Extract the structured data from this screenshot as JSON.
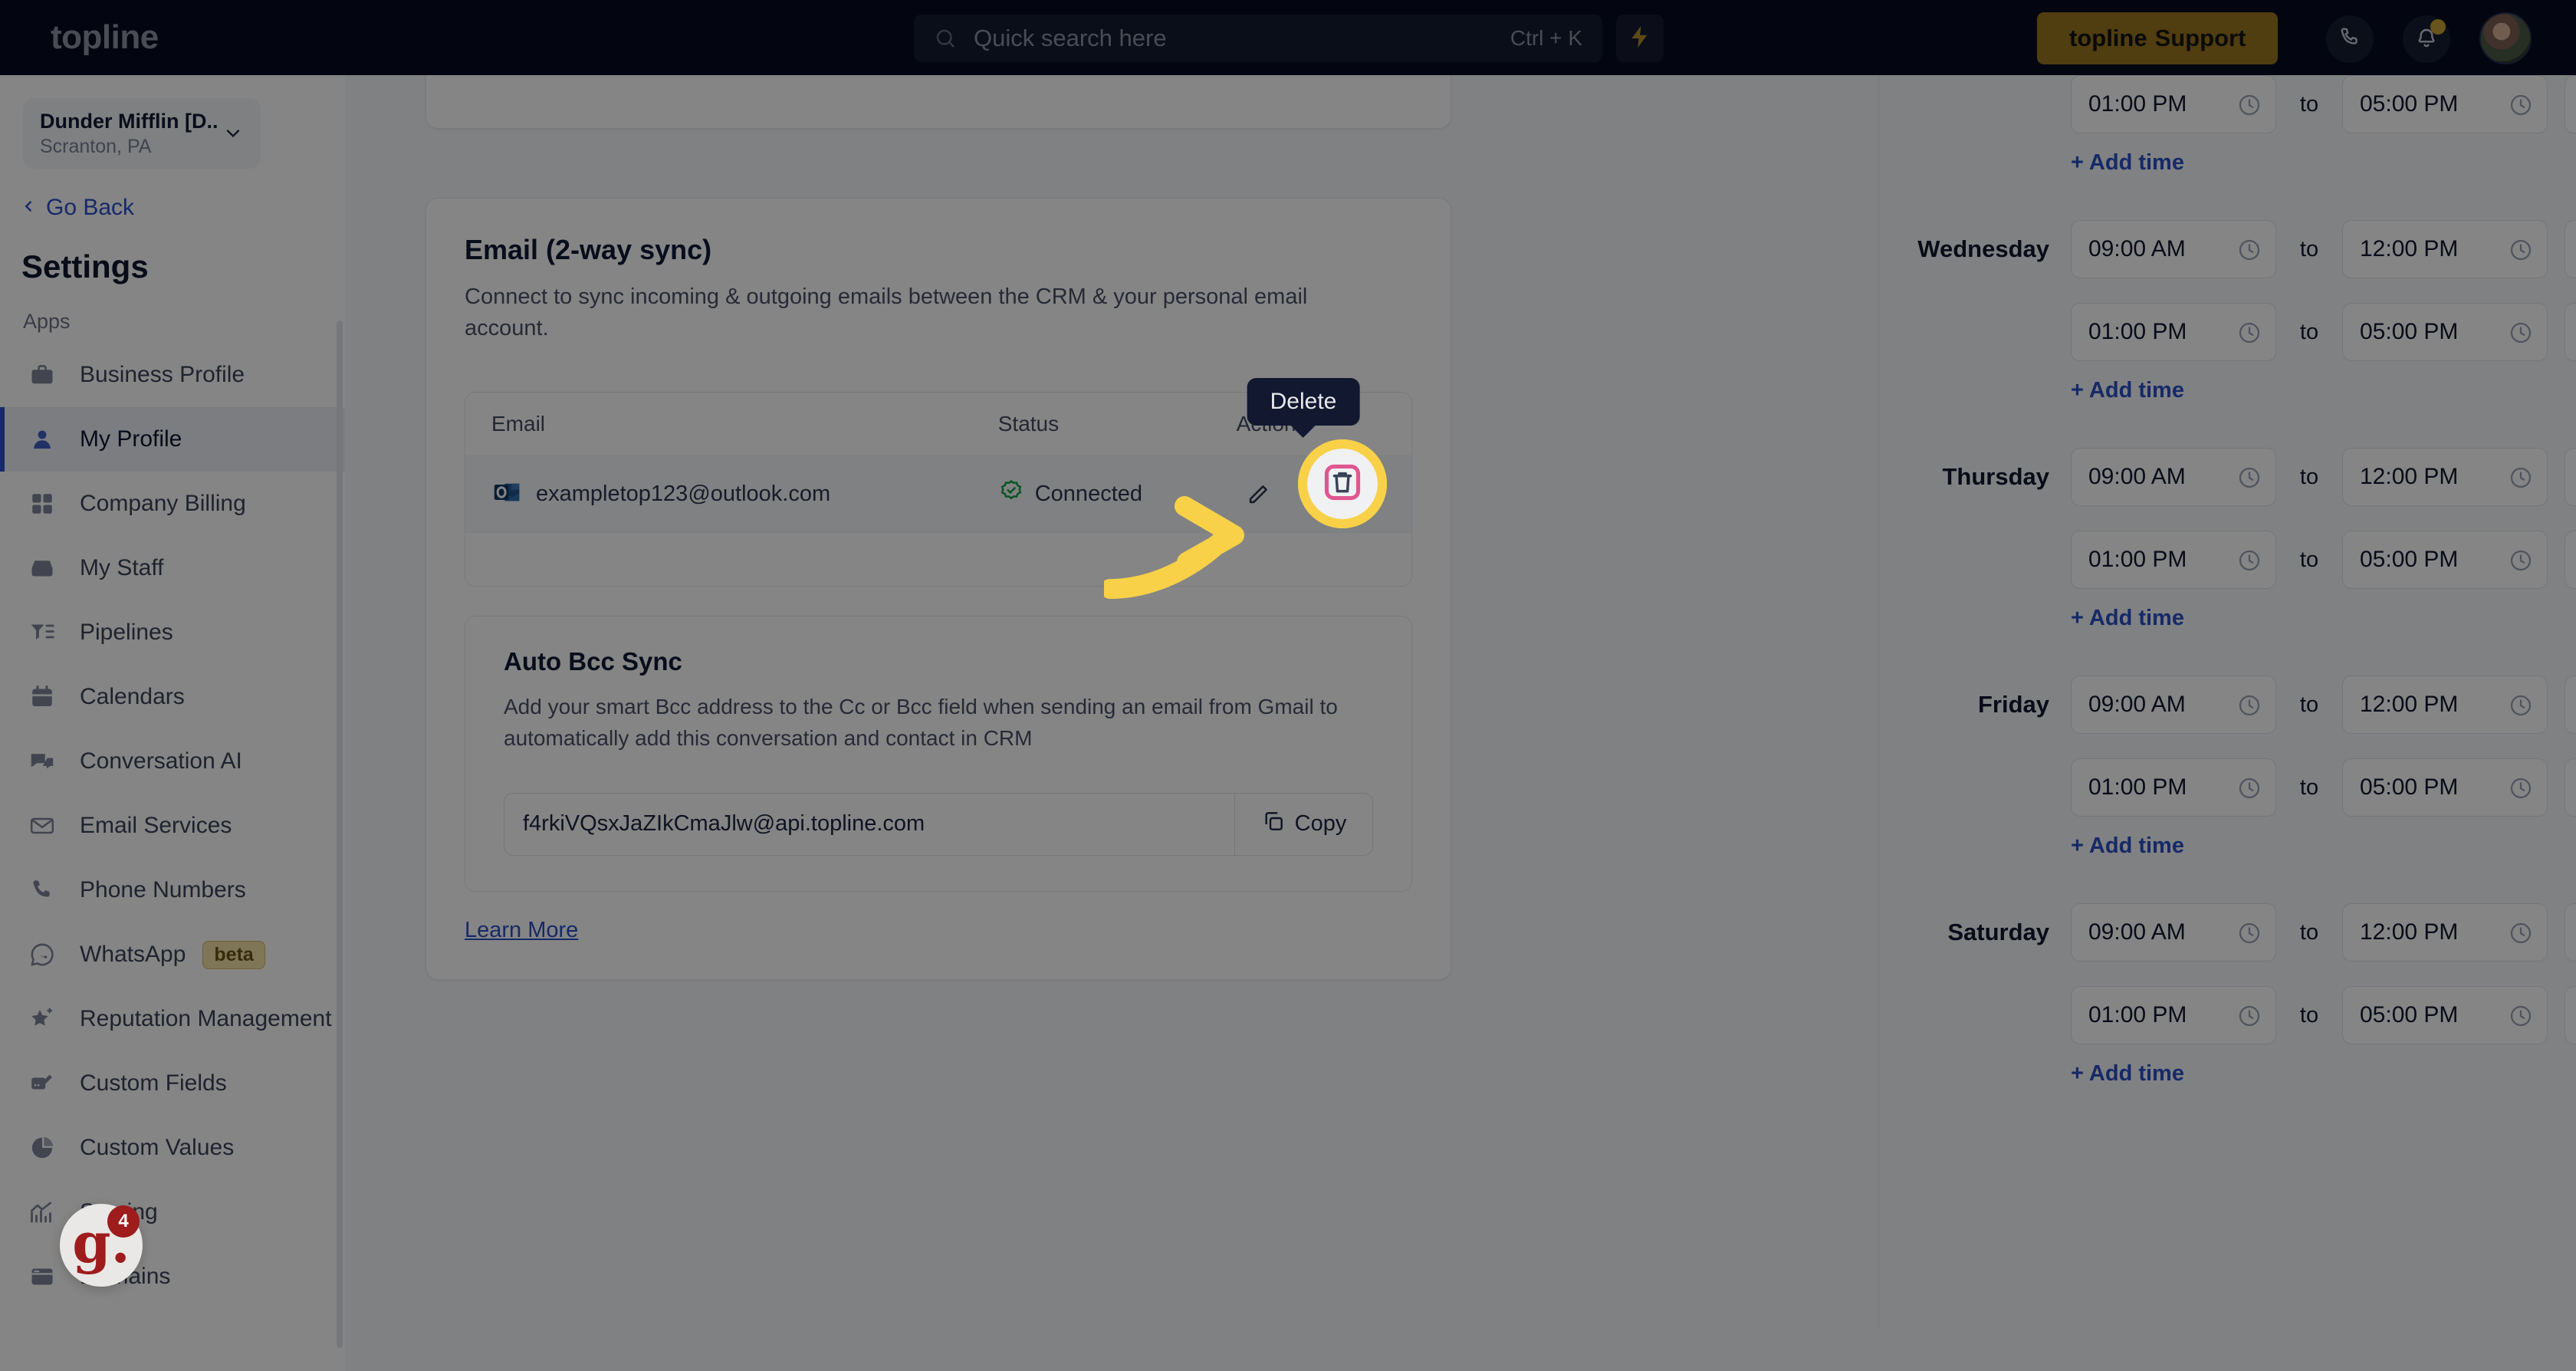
{
  "topbar": {
    "brand": "topline",
    "search": {
      "placeholder": "Quick search here",
      "shortcut": "Ctrl + K",
      "icon": "search-icon"
    },
    "bolt_icon": "lightning-bolt-icon",
    "support_button": {
      "brand_word": "topline",
      "label": "Support"
    },
    "phone_icon": "phone-icon",
    "bell_icon": "bell-icon",
    "avatar": "user-avatar"
  },
  "sidebar": {
    "org": {
      "name": "Dunder Mifflin [D...",
      "location": "Scranton, PA",
      "chevron": "chevron-down-icon"
    },
    "go_back": "Go Back",
    "title": "Settings",
    "group_label": "Apps",
    "items": [
      {
        "label": "Business Profile",
        "icon": "briefcase-icon",
        "active": false
      },
      {
        "label": "My Profile",
        "icon": "user-icon",
        "active": true
      },
      {
        "label": "Company Billing",
        "icon": "calculator-icon",
        "active": false
      },
      {
        "label": "My Staff",
        "icon": "inbox-icon",
        "active": false
      },
      {
        "label": "Pipelines",
        "icon": "filter-list-icon",
        "active": false
      },
      {
        "label": "Calendars",
        "icon": "calendar-icon",
        "active": false
      },
      {
        "label": "Conversation AI",
        "icon": "chat-bubbles-icon",
        "active": false
      },
      {
        "label": "Email Services",
        "icon": "envelope-icon",
        "active": false
      },
      {
        "label": "Phone Numbers",
        "icon": "phone-icon",
        "active": false
      },
      {
        "label": "WhatsApp",
        "icon": "whatsapp-icon",
        "badge": "beta",
        "active": false
      },
      {
        "label": "Reputation Management",
        "icon": "star-sparkle-icon",
        "active": false
      },
      {
        "label": "Custom Fields",
        "icon": "pencil-card-icon",
        "active": false
      },
      {
        "label": "Custom Values",
        "icon": "pie-chart-icon",
        "active": false
      },
      {
        "label": "Scoring",
        "icon": "chart-line-icon",
        "active": false
      },
      {
        "label": "Domains",
        "icon": "browser-window-icon",
        "active": false
      }
    ]
  },
  "email_section": {
    "title": "Email (2-way sync)",
    "description": "Connect to sync incoming & outgoing emails between the CRM & your personal email account.",
    "table": {
      "headers": {
        "email": "Email",
        "status": "Status",
        "action": "Action"
      },
      "rows": [
        {
          "provider_icon": "outlook-icon",
          "email": "exampletop123@outlook.com",
          "status": "Connected",
          "status_icon": "check-circle-icon",
          "actions": [
            "edit-icon",
            "delete-icon"
          ]
        }
      ]
    }
  },
  "bcc_section": {
    "title": "Auto Bcc Sync",
    "description": "Add your smart Bcc address to the Cc or Bcc field when sending an email from Gmail to automatically add this conversation and contact in CRM",
    "address": "f4rkiVQsxJaZIkCmaJlw@api.topline.com",
    "copy_label": "Copy",
    "copy_icon": "copy-icon",
    "learn_more": "Learn More"
  },
  "tooltip": {
    "label": "Delete"
  },
  "highlight": {
    "icon": "delete-trash-icon",
    "ring_color": "#f8d148",
    "icon_color": "#e0568f"
  },
  "chat_widget": {
    "glyph": "g.",
    "badge": "4"
  },
  "business_hours": {
    "to_word": "to",
    "add_time_label": "+ Add time",
    "clock_icon": "clock-icon",
    "copy_icon": "copy-row-icon",
    "delete_icon": "delete-row-icon",
    "days": [
      {
        "label": "",
        "partial": true,
        "rows": [
          {
            "from": "01:00 PM",
            "to": "05:00 PM",
            "action": "delete"
          }
        ]
      },
      {
        "label": "Wednesday",
        "rows": [
          {
            "from": "09:00 AM",
            "to": "12:00 PM",
            "action": "copy"
          },
          {
            "from": "01:00 PM",
            "to": "05:00 PM",
            "action": "delete"
          }
        ]
      },
      {
        "label": "Thursday",
        "rows": [
          {
            "from": "09:00 AM",
            "to": "12:00 PM",
            "action": "copy"
          },
          {
            "from": "01:00 PM",
            "to": "05:00 PM",
            "action": "delete"
          }
        ]
      },
      {
        "label": "Friday",
        "rows": [
          {
            "from": "09:00 AM",
            "to": "12:00 PM",
            "action": "copy"
          },
          {
            "from": "01:00 PM",
            "to": "05:00 PM",
            "action": "delete"
          }
        ]
      },
      {
        "label": "Saturday",
        "rows": [
          {
            "from": "09:00 AM",
            "to": "12:00 PM",
            "action": "copy"
          },
          {
            "from": "01:00 PM",
            "to": "05:00 PM",
            "action": "delete"
          }
        ]
      }
    ]
  }
}
